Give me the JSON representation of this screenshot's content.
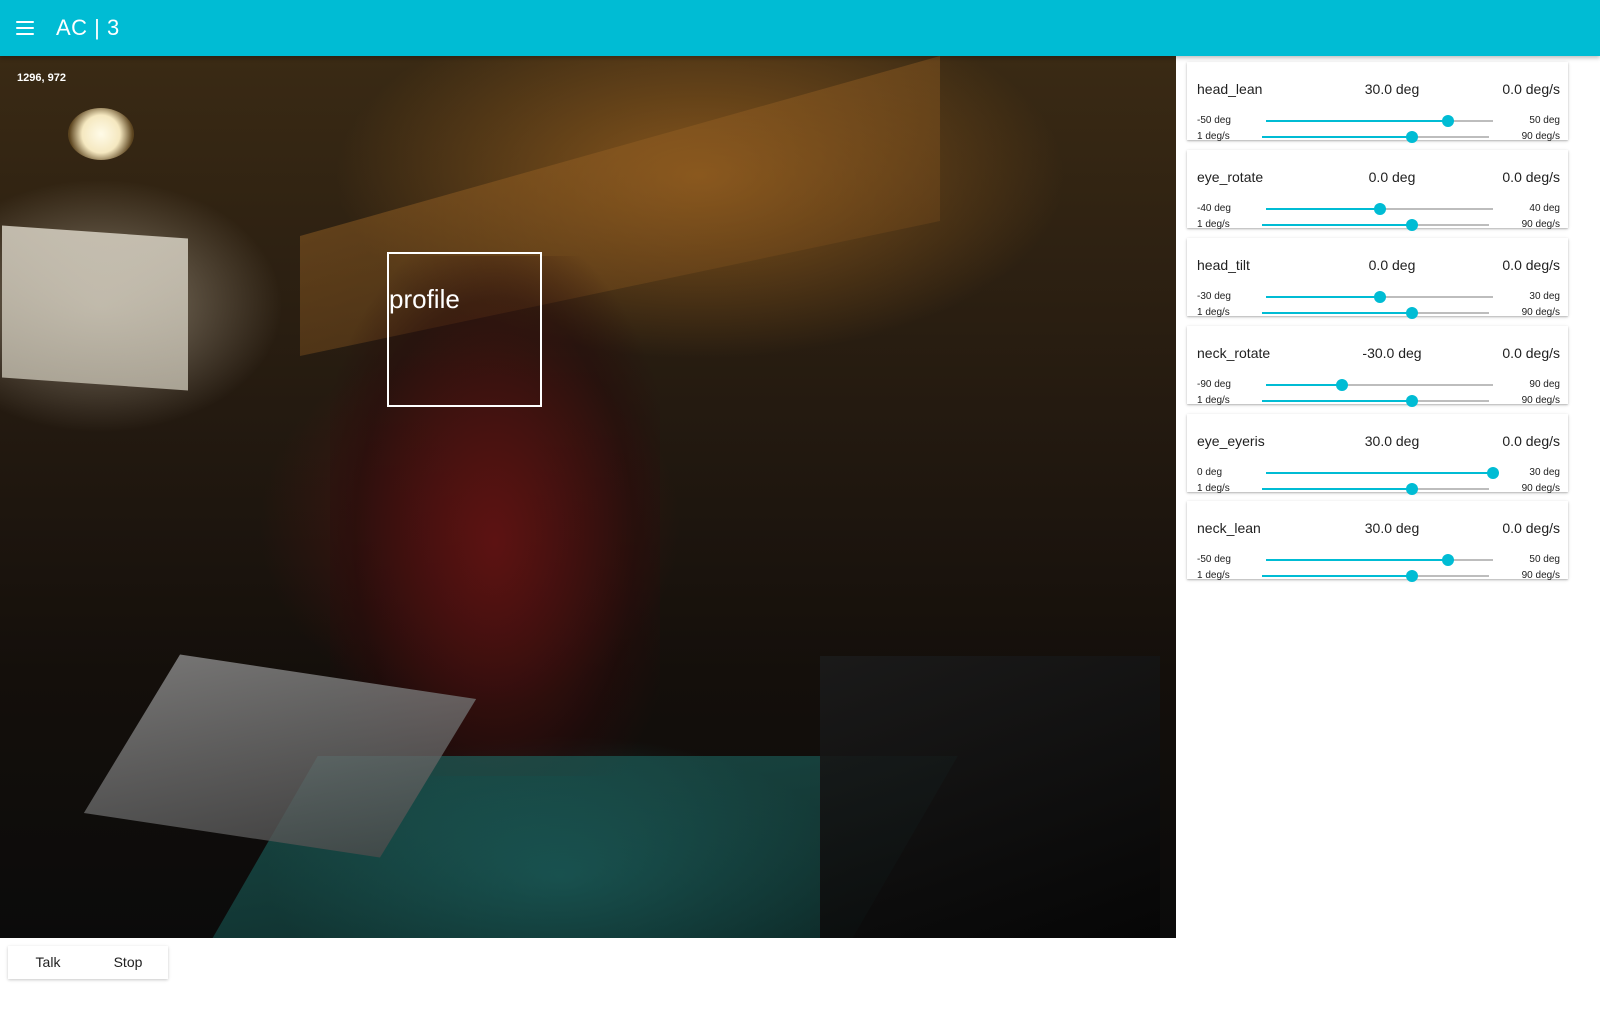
{
  "app": {
    "title": "AC | 3"
  },
  "camera": {
    "coords": "1296, 972",
    "detection_label": "profile"
  },
  "joints": [
    {
      "name": "head_lean",
      "position": "30.0 deg",
      "velocity": "0.0 deg/s",
      "min": "-50 deg",
      "max": "50 deg",
      "vel_min": "1 deg/s",
      "vel_max": "90 deg/s",
      "pos_fraction": 0.8,
      "vel_fraction": 0.66
    },
    {
      "name": "eye_rotate",
      "position": "0.0 deg",
      "velocity": "0.0 deg/s",
      "min": "-40 deg",
      "max": "40 deg",
      "vel_min": "1 deg/s",
      "vel_max": "90 deg/s",
      "pos_fraction": 0.5,
      "vel_fraction": 0.66
    },
    {
      "name": "head_tilt",
      "position": "0.0 deg",
      "velocity": "0.0 deg/s",
      "min": "-30 deg",
      "max": "30 deg",
      "vel_min": "1 deg/s",
      "vel_max": "90 deg/s",
      "pos_fraction": 0.5,
      "vel_fraction": 0.66
    },
    {
      "name": "neck_rotate",
      "position": "-30.0 deg",
      "velocity": "0.0 deg/s",
      "min": "-90 deg",
      "max": "90 deg",
      "vel_min": "1 deg/s",
      "vel_max": "90 deg/s",
      "pos_fraction": 0.333,
      "vel_fraction": 0.66
    },
    {
      "name": "eye_eyeris",
      "position": "30.0 deg",
      "velocity": "0.0 deg/s",
      "min": "0 deg",
      "max": "30 deg",
      "vel_min": "1 deg/s",
      "vel_max": "90 deg/s",
      "pos_fraction": 1.0,
      "vel_fraction": 0.66
    },
    {
      "name": "neck_lean",
      "position": "30.0 deg",
      "velocity": "0.0 deg/s",
      "min": "-50 deg",
      "max": "50 deg",
      "vel_min": "1 deg/s",
      "vel_max": "90 deg/s",
      "pos_fraction": 0.8,
      "vel_fraction": 0.66
    }
  ],
  "toolbar": {
    "talk_label": "Talk",
    "stop_label": "Stop"
  },
  "colors": {
    "accent": "#00bcd4",
    "track": "#bdbdbd"
  }
}
